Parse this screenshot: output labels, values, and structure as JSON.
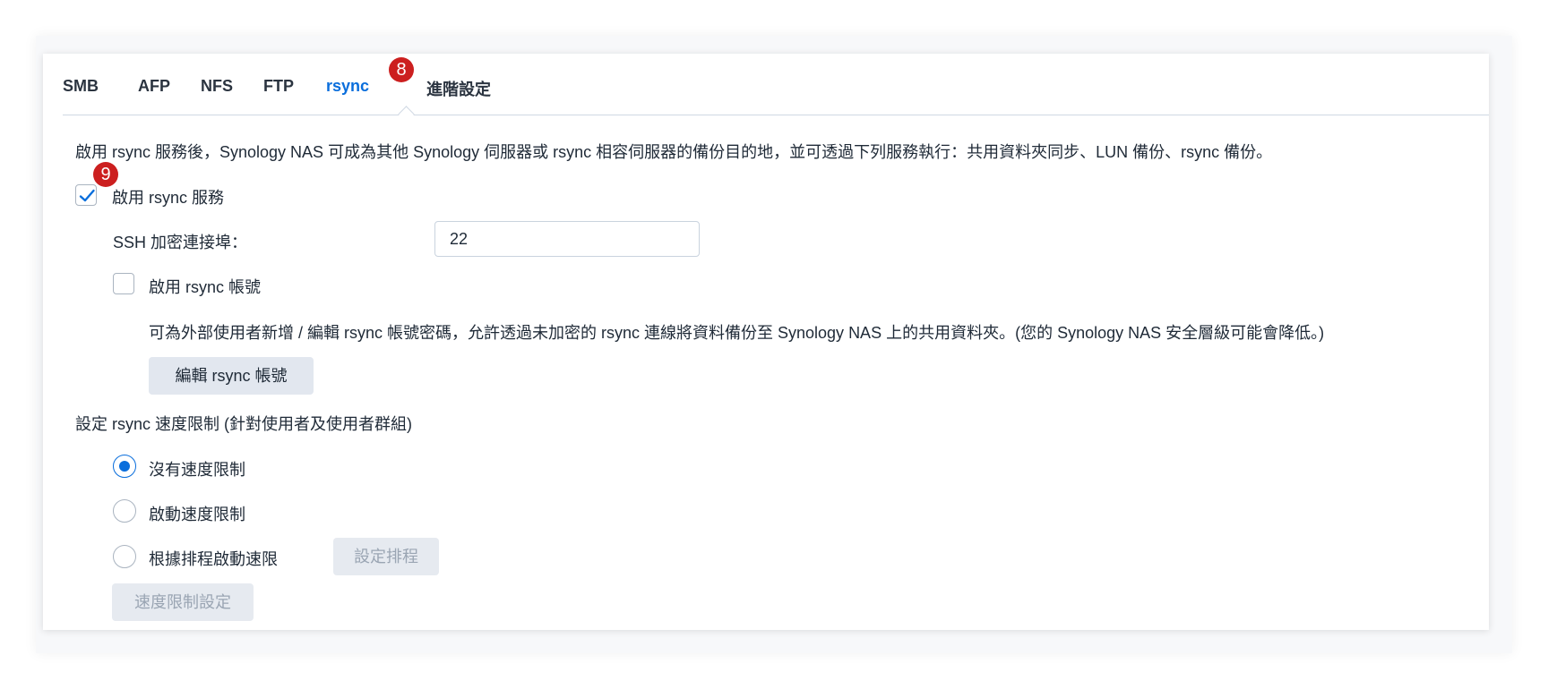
{
  "tabs": [
    {
      "label": "SMB"
    },
    {
      "label": "AFP"
    },
    {
      "label": "NFS"
    },
    {
      "label": "FTP"
    },
    {
      "label": "rsync"
    },
    {
      "label": "進階設定"
    }
  ],
  "active_tab": "rsync",
  "badges": {
    "tab": "8",
    "checkbox": "9"
  },
  "description": "啟用 rsync 服務後，Synology NAS 可成為其他 Synology 伺服器或 rsync 相容伺服器的備份目的地，並可透過下列服務執行：共用資料夾同步、LUN 備份、rsync 備份。",
  "enable_service": {
    "label": "啟用 rsync 服務",
    "checked": true
  },
  "ssh_port": {
    "label": "SSH 加密連接埠：",
    "value": "22"
  },
  "enable_account": {
    "label": "啟用 rsync 帳號",
    "checked": false
  },
  "account_note": "可為外部使用者新增 / 編輯 rsync 帳號密碼，允許透過未加密的 rsync 連線將資料備份至 Synology NAS 上的共用資料夾。(您的 Synology NAS 安全層級可能會降低。)",
  "edit_account_button": "編輯 rsync 帳號",
  "speed_limit": {
    "heading": "設定 rsync 速度限制 (針對使用者及使用者群組)",
    "options": [
      {
        "label": "沒有速度限制",
        "checked": true
      },
      {
        "label": "啟動速度限制",
        "checked": false
      },
      {
        "label": "根據排程啟動速限",
        "checked": false
      }
    ],
    "schedule_button": "設定排程",
    "settings_button": "速度限制設定"
  },
  "colors": {
    "accent": "#0a6edc",
    "badge": "#cc1f1f",
    "text": "#1f2a37"
  }
}
